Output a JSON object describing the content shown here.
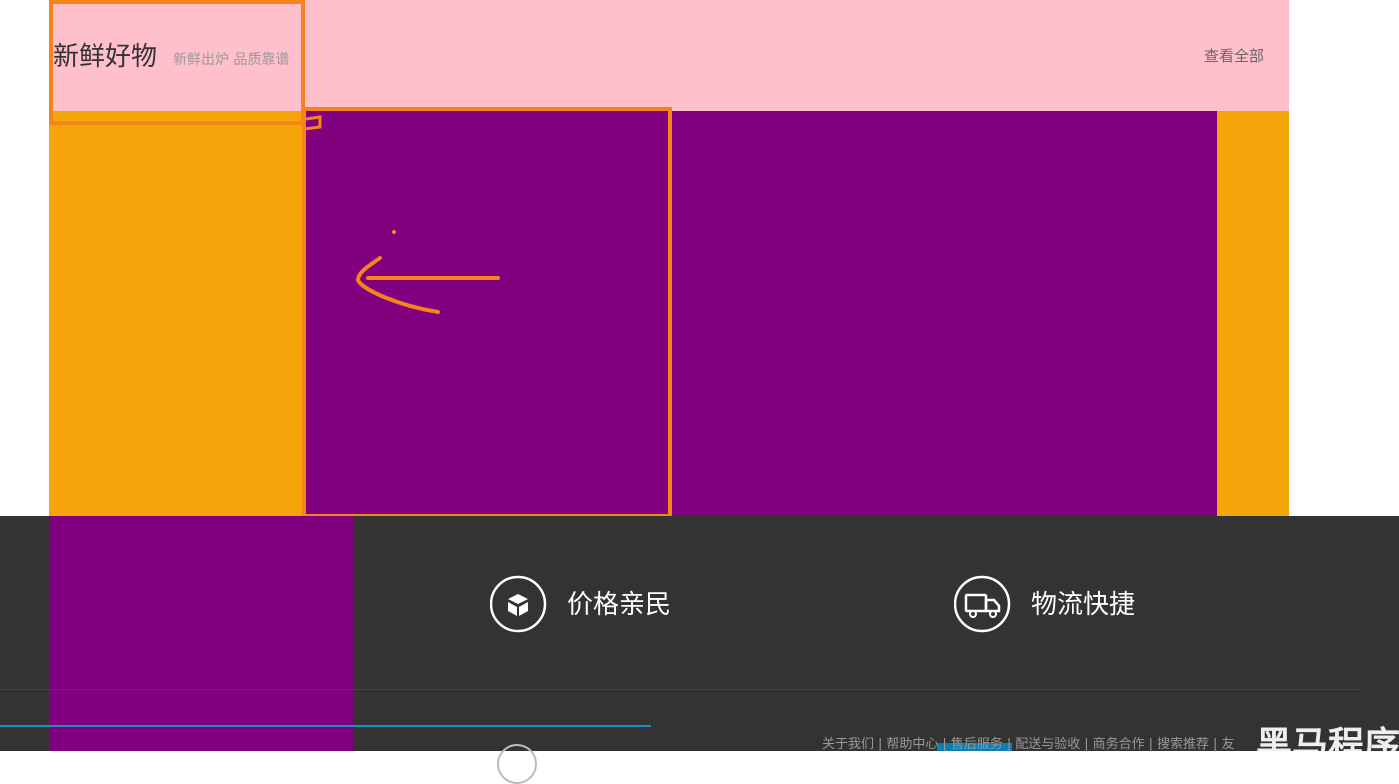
{
  "section": {
    "title": "新鲜好物",
    "subtitle": "新鲜出炉 品质靠谱",
    "view_all": "查看全部"
  },
  "colors": {
    "header_bg": "#FFC0CB",
    "block_orange": "#F5A50A",
    "block_purple": "#800080",
    "annotation_orange": "#F58419",
    "footer_bg": "#333333",
    "progress_blue": "#1C8CC4"
  },
  "features": [
    {
      "icon": "box-icon",
      "label": "价格亲民"
    },
    {
      "icon": "truck-icon",
      "label": "物流快捷"
    }
  ],
  "footer": {
    "links": [
      "关于我们",
      "帮助中心",
      "售后服务",
      "配送与验收",
      "商务合作",
      "搜索推荐",
      "友"
    ],
    "separator": "|"
  },
  "annotation": {
    "arrow": "left-arrow-annotation"
  },
  "watermark": "黑马程序"
}
